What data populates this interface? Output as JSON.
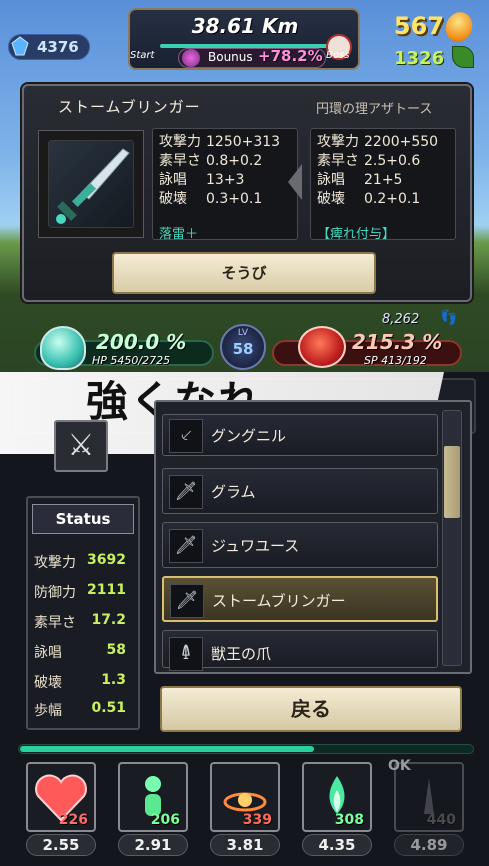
{
  "hud": {
    "gems": "4376",
    "distance": "38.61 Km",
    "start_label": "Start",
    "boss_label": "Boss",
    "bonus_label": "Bounus",
    "bonus_value": "+78.2%",
    "coins": "567",
    "leaves": "1326"
  },
  "item": {
    "name": "ストームブリンガー",
    "compare_name": "円環の理アザトース",
    "current": {
      "stats": [
        {
          "k": "攻撃力",
          "v": "1250+313"
        },
        {
          "k": "素早さ",
          "v": "0.8+0.2"
        },
        {
          "k": "詠唱",
          "v": "13+3"
        },
        {
          "k": "破壊",
          "v": "0.3+0.1"
        }
      ],
      "effect": "落雷＋"
    },
    "compare": {
      "stats": [
        {
          "k": "攻撃力",
          "v": "2200+550"
        },
        {
          "k": "素早さ",
          "v": "2.5+0.6"
        },
        {
          "k": "詠唱",
          "v": "21+5"
        },
        {
          "k": "破壊",
          "v": "0.2+0.1"
        }
      ],
      "effect": "【痺れ付与】"
    },
    "equip_label": "そうび"
  },
  "gauges": {
    "hp_pct": "200.0 %",
    "hp_sub": "HP 5450/2725",
    "level_label": "LV",
    "level": "58",
    "sp_pct": "215.3 %",
    "sp_sub": "SP 413/192",
    "steps": "8,262"
  },
  "banner": {
    "text": "強くなれ"
  },
  "status": {
    "title": "Status",
    "rows": [
      {
        "k": "攻撃力",
        "v": "3692"
      },
      {
        "k": "防御力",
        "v": "2111"
      },
      {
        "k": "素早さ",
        "v": "17.2"
      },
      {
        "k": "詠唱",
        "v": "58"
      },
      {
        "k": "破壊",
        "v": "1.3"
      },
      {
        "k": "歩幅",
        "v": "0.51"
      }
    ]
  },
  "weapon_list": [
    {
      "label": "グングニル",
      "icon": "spear-icon",
      "selected": false
    },
    {
      "label": "グラム",
      "icon": "sword-icon",
      "selected": false
    },
    {
      "label": "ジュワユース",
      "icon": "sword-icon",
      "selected": false
    },
    {
      "label": "ストームブリンガー",
      "icon": "sword-icon",
      "selected": true
    },
    {
      "label": "獣王の爪",
      "icon": "claw-icon",
      "selected": false
    }
  ],
  "back_label": "戻る",
  "skills": [
    {
      "count": "226",
      "value": "2.55",
      "icon": "heart-icon",
      "color": "#ff6a6a"
    },
    {
      "count": "206",
      "value": "2.91",
      "icon": "figure-icon",
      "color": "#7aff9a"
    },
    {
      "count": "339",
      "value": "3.81",
      "icon": "fire-icon",
      "color": "#ff6a5a"
    },
    {
      "count": "308",
      "value": "4.35",
      "icon": "flame-icon",
      "color": "#7aff9a"
    },
    {
      "count": "440",
      "value": "4.89",
      "icon": "locked-icon",
      "color": "#8a8a8a"
    }
  ],
  "ok_label": "OK"
}
